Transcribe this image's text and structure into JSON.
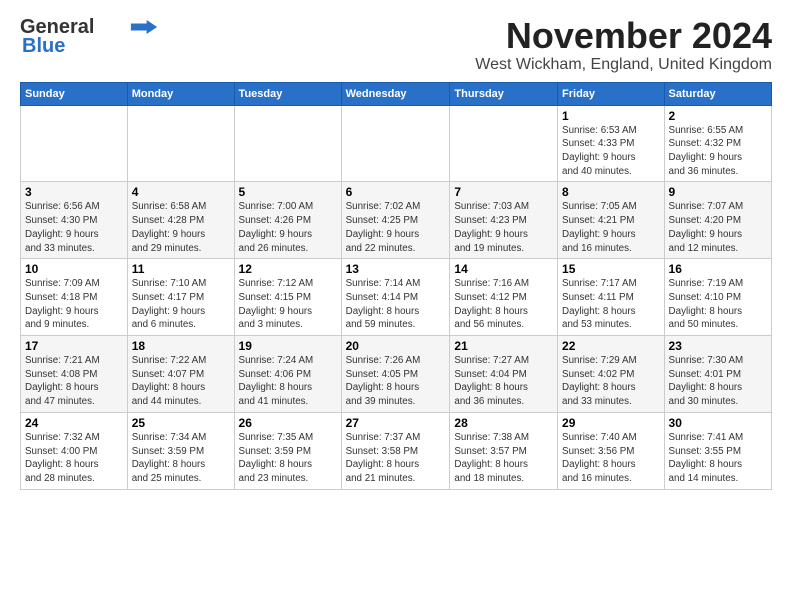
{
  "logo": {
    "line1": "General",
    "line2": "Blue"
  },
  "title": "November 2024",
  "subtitle": "West Wickham, England, United Kingdom",
  "headers": [
    "Sunday",
    "Monday",
    "Tuesday",
    "Wednesday",
    "Thursday",
    "Friday",
    "Saturday"
  ],
  "weeks": [
    [
      {
        "day": "",
        "info": ""
      },
      {
        "day": "",
        "info": ""
      },
      {
        "day": "",
        "info": ""
      },
      {
        "day": "",
        "info": ""
      },
      {
        "day": "",
        "info": ""
      },
      {
        "day": "1",
        "info": "Sunrise: 6:53 AM\nSunset: 4:33 PM\nDaylight: 9 hours\nand 40 minutes."
      },
      {
        "day": "2",
        "info": "Sunrise: 6:55 AM\nSunset: 4:32 PM\nDaylight: 9 hours\nand 36 minutes."
      }
    ],
    [
      {
        "day": "3",
        "info": "Sunrise: 6:56 AM\nSunset: 4:30 PM\nDaylight: 9 hours\nand 33 minutes."
      },
      {
        "day": "4",
        "info": "Sunrise: 6:58 AM\nSunset: 4:28 PM\nDaylight: 9 hours\nand 29 minutes."
      },
      {
        "day": "5",
        "info": "Sunrise: 7:00 AM\nSunset: 4:26 PM\nDaylight: 9 hours\nand 26 minutes."
      },
      {
        "day": "6",
        "info": "Sunrise: 7:02 AM\nSunset: 4:25 PM\nDaylight: 9 hours\nand 22 minutes."
      },
      {
        "day": "7",
        "info": "Sunrise: 7:03 AM\nSunset: 4:23 PM\nDaylight: 9 hours\nand 19 minutes."
      },
      {
        "day": "8",
        "info": "Sunrise: 7:05 AM\nSunset: 4:21 PM\nDaylight: 9 hours\nand 16 minutes."
      },
      {
        "day": "9",
        "info": "Sunrise: 7:07 AM\nSunset: 4:20 PM\nDaylight: 9 hours\nand 12 minutes."
      }
    ],
    [
      {
        "day": "10",
        "info": "Sunrise: 7:09 AM\nSunset: 4:18 PM\nDaylight: 9 hours\nand 9 minutes."
      },
      {
        "day": "11",
        "info": "Sunrise: 7:10 AM\nSunset: 4:17 PM\nDaylight: 9 hours\nand 6 minutes."
      },
      {
        "day": "12",
        "info": "Sunrise: 7:12 AM\nSunset: 4:15 PM\nDaylight: 9 hours\nand 3 minutes."
      },
      {
        "day": "13",
        "info": "Sunrise: 7:14 AM\nSunset: 4:14 PM\nDaylight: 8 hours\nand 59 minutes."
      },
      {
        "day": "14",
        "info": "Sunrise: 7:16 AM\nSunset: 4:12 PM\nDaylight: 8 hours\nand 56 minutes."
      },
      {
        "day": "15",
        "info": "Sunrise: 7:17 AM\nSunset: 4:11 PM\nDaylight: 8 hours\nand 53 minutes."
      },
      {
        "day": "16",
        "info": "Sunrise: 7:19 AM\nSunset: 4:10 PM\nDaylight: 8 hours\nand 50 minutes."
      }
    ],
    [
      {
        "day": "17",
        "info": "Sunrise: 7:21 AM\nSunset: 4:08 PM\nDaylight: 8 hours\nand 47 minutes."
      },
      {
        "day": "18",
        "info": "Sunrise: 7:22 AM\nSunset: 4:07 PM\nDaylight: 8 hours\nand 44 minutes."
      },
      {
        "day": "19",
        "info": "Sunrise: 7:24 AM\nSunset: 4:06 PM\nDaylight: 8 hours\nand 41 minutes."
      },
      {
        "day": "20",
        "info": "Sunrise: 7:26 AM\nSunset: 4:05 PM\nDaylight: 8 hours\nand 39 minutes."
      },
      {
        "day": "21",
        "info": "Sunrise: 7:27 AM\nSunset: 4:04 PM\nDaylight: 8 hours\nand 36 minutes."
      },
      {
        "day": "22",
        "info": "Sunrise: 7:29 AM\nSunset: 4:02 PM\nDaylight: 8 hours\nand 33 minutes."
      },
      {
        "day": "23",
        "info": "Sunrise: 7:30 AM\nSunset: 4:01 PM\nDaylight: 8 hours\nand 30 minutes."
      }
    ],
    [
      {
        "day": "24",
        "info": "Sunrise: 7:32 AM\nSunset: 4:00 PM\nDaylight: 8 hours\nand 28 minutes."
      },
      {
        "day": "25",
        "info": "Sunrise: 7:34 AM\nSunset: 3:59 PM\nDaylight: 8 hours\nand 25 minutes."
      },
      {
        "day": "26",
        "info": "Sunrise: 7:35 AM\nSunset: 3:59 PM\nDaylight: 8 hours\nand 23 minutes."
      },
      {
        "day": "27",
        "info": "Sunrise: 7:37 AM\nSunset: 3:58 PM\nDaylight: 8 hours\nand 21 minutes."
      },
      {
        "day": "28",
        "info": "Sunrise: 7:38 AM\nSunset: 3:57 PM\nDaylight: 8 hours\nand 18 minutes."
      },
      {
        "day": "29",
        "info": "Sunrise: 7:40 AM\nSunset: 3:56 PM\nDaylight: 8 hours\nand 16 minutes."
      },
      {
        "day": "30",
        "info": "Sunrise: 7:41 AM\nSunset: 3:55 PM\nDaylight: 8 hours\nand 14 minutes."
      }
    ]
  ]
}
